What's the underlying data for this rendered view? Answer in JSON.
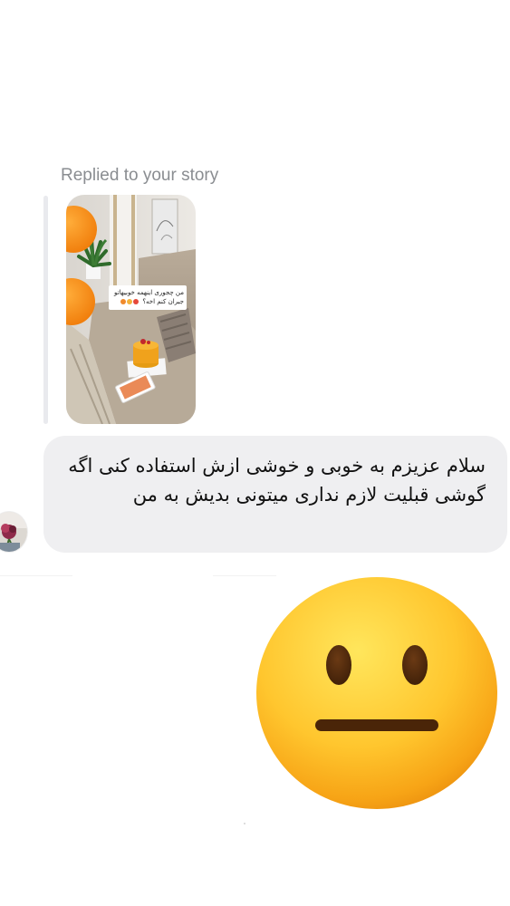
{
  "reply": {
    "label": "Replied to your story",
    "story_sticker_text": "من چجوری اینهمه خوبیهاتو جبران کنم اخه؟",
    "story_sticker_emojis": [
      "#e6493a",
      "#f3b23a",
      "#f08a2c"
    ]
  },
  "message": {
    "text": "سلام عزیزم به خوبی و خوشی ازش استفاده کنی اگه گوشی قبلیت لازم نداری میتونی بدیش به من"
  },
  "reaction": {
    "emoji": "neutral-face-emoji"
  },
  "colors": {
    "bubble_bg": "#efeff1",
    "label_gray": "#8a8d91",
    "reply_bar": "#e9eaee",
    "emoji_yellow": "#ffc62e"
  }
}
